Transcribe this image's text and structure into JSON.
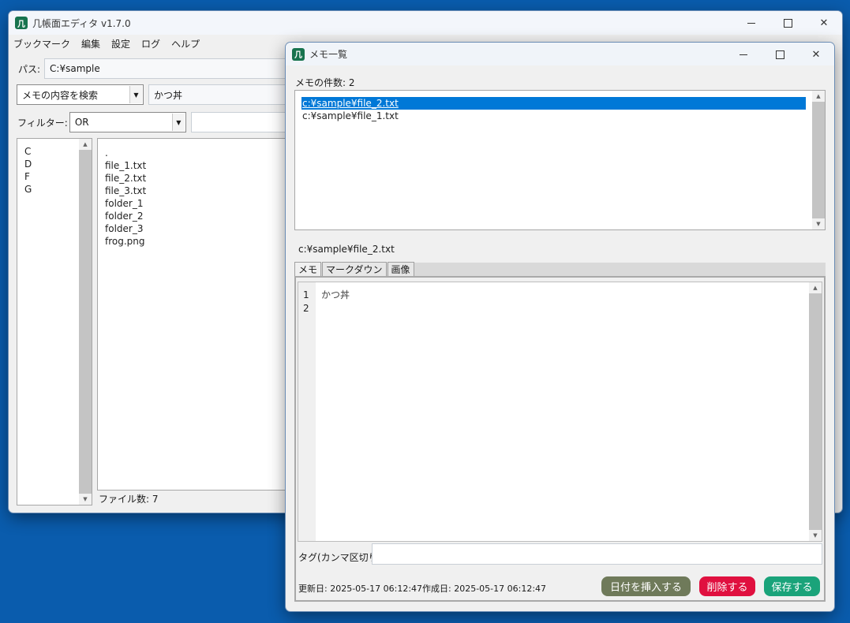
{
  "main_window": {
    "title": "几帳面エディタ v1.7.0",
    "app_icon_glyph": "几",
    "menu": [
      "ブックマーク",
      "編集",
      "設定",
      "ログ",
      "ヘルプ"
    ],
    "path_label": "パス:",
    "path_value": "C:¥sample",
    "search_mode": "メモの内容を検索",
    "search_value": "かつ丼",
    "filter_label": "フィルター:",
    "filter_value": "OR",
    "filter_text": "",
    "drives": [
      "C",
      "D",
      "F",
      "G"
    ],
    "files": [
      ".",
      "file_1.txt",
      "file_2.txt",
      "file_3.txt",
      "folder_1",
      "folder_2",
      "folder_3",
      "frog.png"
    ],
    "file_count": "ファイル数: 7"
  },
  "memo_window": {
    "title": "メモ一覧",
    "app_icon_glyph": "几",
    "memo_count": "メモの件数: 2",
    "memos": [
      {
        "path": "c:¥sample¥file_2.txt",
        "selected": true
      },
      {
        "path": "c:¥sample¥file_1.txt",
        "selected": false
      }
    ],
    "current_path": "c:¥sample¥file_2.txt",
    "tabs": [
      "メモ",
      "マークダウン",
      "画像"
    ],
    "line_numbers": [
      "1",
      "2"
    ],
    "editor_text": "かつ丼",
    "tag_label": "タグ(カンマ区切り):",
    "tag_value": "",
    "updated": "更新日: 2025-05-17 06:12:47",
    "created": "作成日: 2025-05-17 06:12:47",
    "buttons": {
      "insert_date": "日付を挿入する",
      "delete": "削除する",
      "save": "保存する"
    }
  },
  "colors": {
    "desktop": "#0a5cad",
    "selection": "#0078d7",
    "insert_date_button": "#6f7a5a",
    "delete_button": "#e0103f",
    "save_button": "#1aa37a",
    "app_icon": "#17734e"
  }
}
